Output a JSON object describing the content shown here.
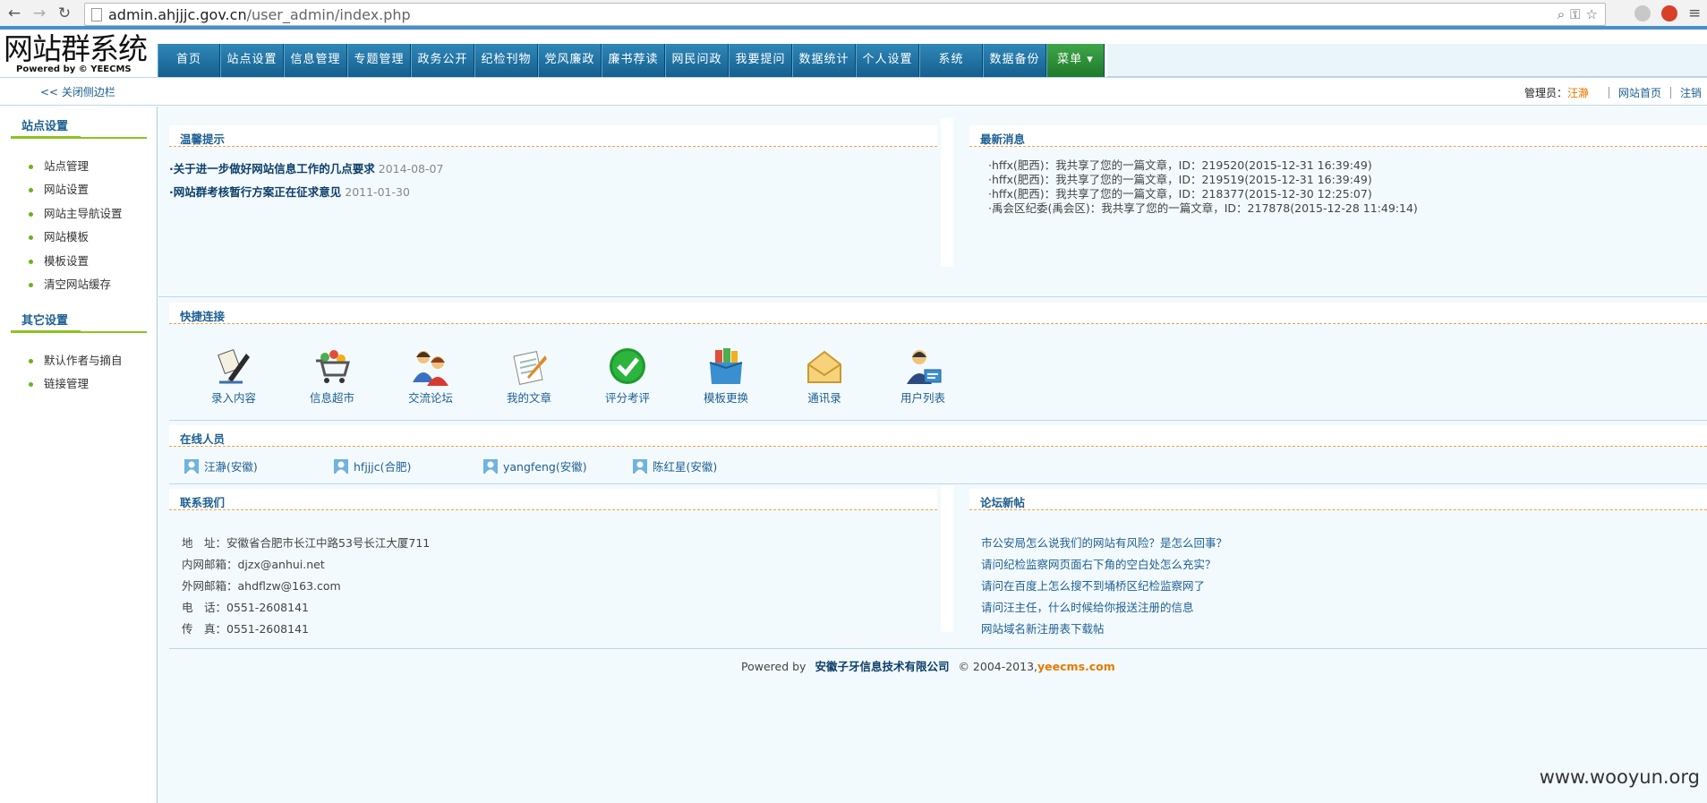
{
  "browser": {
    "url_host": "admin.ahjjjc.gov.cn",
    "url_path": "/user_admin/index.php"
  },
  "header": {
    "logo_title": "网站群系统",
    "logo_sub": "Powered by © YEECMS",
    "nav": [
      "首页",
      "站点设置",
      "信息管理",
      "专题管理",
      "政务公开",
      "纪检刊物",
      "党风廉政",
      "廉书荐读",
      "网民问政",
      "我要提问",
      "数据统计",
      "个人设置",
      "系统",
      "数据备份",
      "菜单 ▾"
    ]
  },
  "topbar": {
    "close_sidebar": "<< 关闭侧边栏",
    "admin_label": "管理员：",
    "admin_name": "汪瀞",
    "site_home": "网站首页",
    "logout": "注销"
  },
  "sidebar": {
    "section1_title": "站点设置",
    "section1_items": [
      "站点管理",
      "网站设置",
      "网站主导航设置",
      "网站模板",
      "模板设置",
      "清空网站缓存"
    ],
    "section2_title": "其它设置",
    "section2_items": [
      "默认作者与摘自",
      "链接管理"
    ]
  },
  "tips": {
    "title": "温馨提示",
    "items": [
      {
        "text": "·关于进一步做好网站信息工作的几点要求",
        "date": "2014-08-07"
      },
      {
        "text": "·网站群考核暂行方案正在征求意见",
        "date": "2011-01-30"
      }
    ]
  },
  "news": {
    "title": "最新消息",
    "items": [
      "·hffx(肥西)：我共享了您的一篇文章，ID：219520(2015-12-31 16:39:49)",
      "·hffx(肥西)：我共享了您的一篇文章，ID：219519(2015-12-31 16:39:49)",
      "·hffx(肥西)：我共享了您的一篇文章，ID：218377(2015-12-30 12:25:07)",
      "·禹会区纪委(禹会区)：我共享了您的一篇文章，ID：217878(2015-12-28 11:49:14)"
    ]
  },
  "quick": {
    "title": "快捷连接",
    "items": [
      {
        "label": "录入内容",
        "icon": "pen-icon"
      },
      {
        "label": "信息超市",
        "icon": "cart-icon"
      },
      {
        "label": "交流论坛",
        "icon": "users-icon"
      },
      {
        "label": "我的文章",
        "icon": "doc-icon"
      },
      {
        "label": "评分考评",
        "icon": "check-icon"
      },
      {
        "label": "模板更换",
        "icon": "box-icon"
      },
      {
        "label": "通讯录",
        "icon": "envelope-icon"
      },
      {
        "label": "用户列表",
        "icon": "userlist-icon"
      }
    ]
  },
  "online": {
    "title": "在线人员",
    "users": [
      "汪瀞(安徽)",
      "hfjjjc(合肥)",
      "yangfeng(安徽)",
      "陈红星(安徽)"
    ]
  },
  "contact": {
    "title": "联系我们",
    "rows": [
      "地　址：安徽省合肥市长江中路53号长江大厦711",
      "内网邮箱：djzx@anhui.net",
      "外网邮箱：ahdflzw@163.com",
      "电　话：0551-2608141",
      "传　真：0551-2608141"
    ]
  },
  "forum": {
    "title": "论坛新帖",
    "items": [
      "市公安局怎么说我们的网站有风险？是怎么回事？",
      "请问纪检监察网页面右下角的空白处怎么充实？",
      "请问在百度上怎么搜不到埇桥区纪检监察网了",
      "请问汪主任，什么时候给你报送注册的信息",
      "网站域名新注册表下载帖"
    ]
  },
  "footer": {
    "powered": "Powered by",
    "company": "安徽子牙信息技术有限公司",
    "copy": "© 2004-2013,",
    "site": "yeecms.com"
  },
  "watermark": "www.wooyun.org"
}
